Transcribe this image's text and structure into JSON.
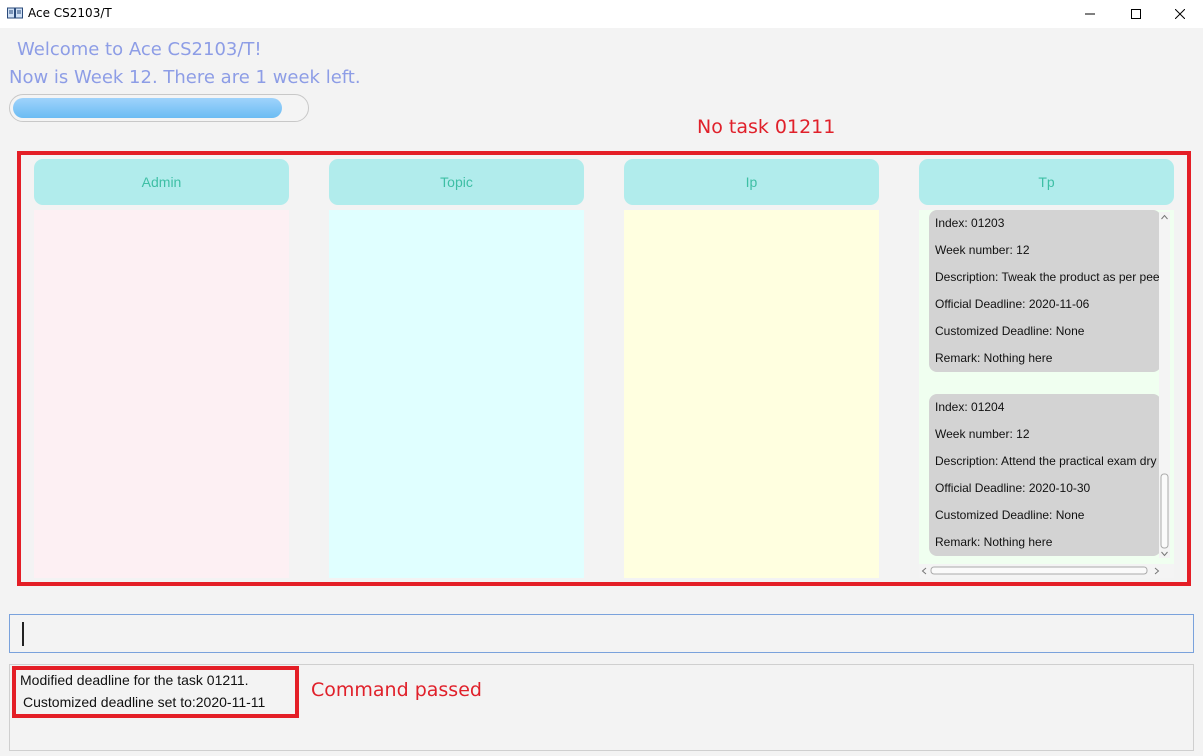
{
  "window": {
    "title": "Ace CS2103/T",
    "app_icon": "book-icon",
    "controls": [
      "minimize-icon",
      "maximize-icon",
      "close-icon"
    ]
  },
  "header": {
    "welcome": "Welcome to Ace CS2103/T!",
    "week_info": "Now is Week 12. There are 1 week left.",
    "progress_fraction": 0.92
  },
  "annotations": {
    "top_note": "No task 01211",
    "bottom_note": "Command passed"
  },
  "columns": [
    {
      "label": "Admin",
      "color": "#fdf0f3"
    },
    {
      "label": "Topic",
      "color": "#e0ffff"
    },
    {
      "label": "Ip",
      "color": "#ffffe0"
    },
    {
      "label": "Tp",
      "color": "#f0fff0"
    }
  ],
  "tp_tasks": [
    {
      "index": "Index: 01203",
      "week": "Week number: 12",
      "description": "Description: Tweak the product as per peer",
      "official": "Official Deadline: 2020-11-06",
      "customized": "Customized Deadline: None",
      "remark": "Remark: Nothing here"
    },
    {
      "index": "Index: 01204",
      "week": "Week number: 12",
      "description": "Description: Attend the practical exam dry",
      "official": "Official Deadline: 2020-10-30",
      "customized": "Customized Deadline: None",
      "remark": "Remark: Nothing here"
    }
  ],
  "command": {
    "value": "",
    "placeholder": ""
  },
  "result": {
    "line1": "Modified deadline for the task 01211.",
    "line2": "Customized deadline set to:2020-11-11"
  },
  "colors": {
    "accent_red": "#e41e26",
    "header_bg": "#b1ecec",
    "header_text": "#3ebfa5",
    "welcome_text": "#8d9de6",
    "card_bg": "#d3d3d3"
  }
}
